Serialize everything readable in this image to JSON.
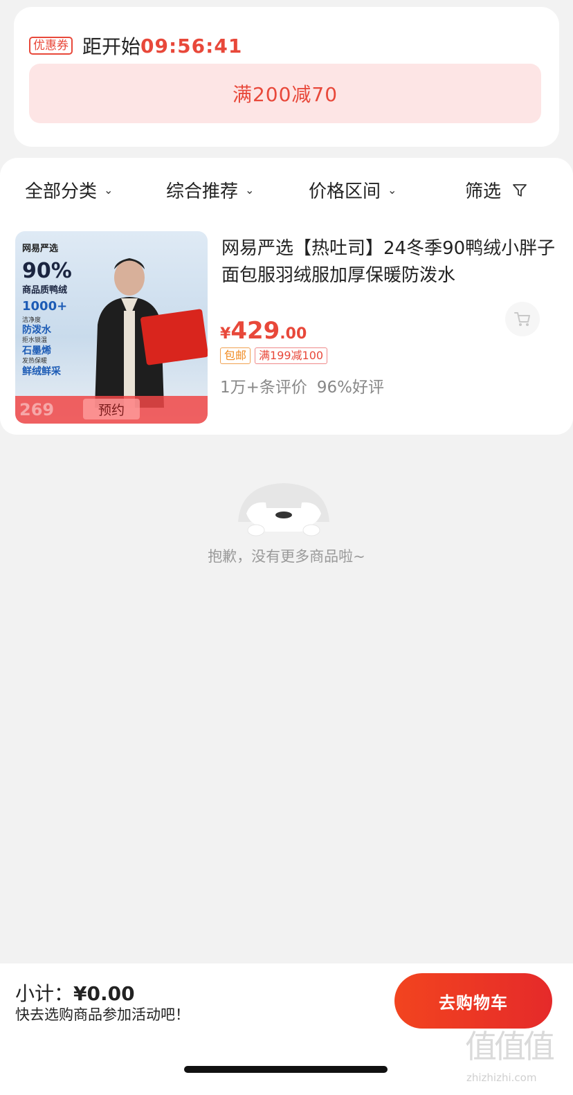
{
  "coupon": {
    "badge": "优惠券",
    "start_label": "距开始",
    "timer": "09:56:41",
    "offer": "满200减70"
  },
  "filters": {
    "category": "全部分类",
    "sort": "综合推荐",
    "price": "价格区间",
    "filter": "筛选"
  },
  "product": {
    "title": "网易严选【热吐司】24冬季90鸭绒小胖子面包服羽绒服加厚保暖防泼水",
    "price_symbol": "¥",
    "price_int": "429",
    "price_dec": ".00",
    "tag_shipping": "包邮",
    "tag_promo": "满199减100",
    "review_count": "1万+条评价",
    "positive_rate": "96%好评",
    "image": {
      "brand": "网易严选",
      "headline": "90%",
      "sub": "商品质鸭绒",
      "k1": "1000+",
      "k1_sub": "洁净度",
      "k2": "防泼水",
      "k2_sub": "拒水锁温",
      "k3": "石墨烯",
      "k3_sub": "发热保暖",
      "k4": "鲜绒鲜采",
      "ghost_price": "269",
      "reserve": "预约"
    }
  },
  "empty": {
    "message": "抱歉，没有更多商品啦~"
  },
  "footer": {
    "subtotal_label": "小计：",
    "subtotal_amount": "¥0.00",
    "hint": "快去选购商品参加活动吧！",
    "go_cart": "去购物车"
  },
  "watermark": {
    "glyphs": "值值值",
    "url": "zhizhizhi.com"
  },
  "colors": {
    "accent": "#e8483a",
    "coupon_bg": "#fde5e5",
    "page_bg": "#f2f2f2",
    "shipping_tag": "#f08a20"
  }
}
